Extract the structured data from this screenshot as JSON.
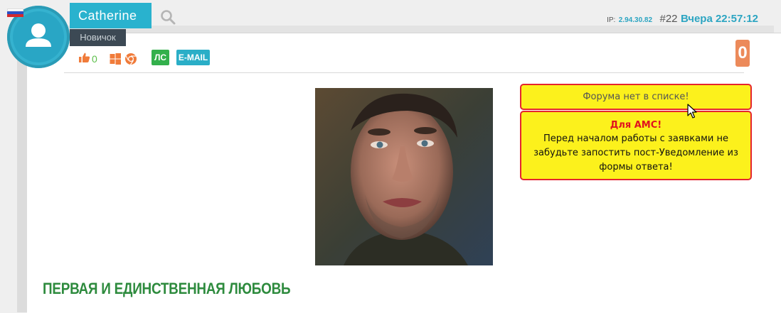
{
  "user": {
    "name": "Catherine",
    "rank": "Новичок",
    "flag": "russia-flag-icon",
    "avatar_icon": "default-user-avatar-icon"
  },
  "meta": {
    "ip_label": "IP:",
    "ip_value": "2.94.30.82",
    "post_number": "#22",
    "date": "Вчера 22:57:12"
  },
  "actions": {
    "reputation": "0",
    "pm_label": "ЛС",
    "email_label": "E-MAIL",
    "counter": "0"
  },
  "notices": {
    "forum_status": "Форума нет в списке!",
    "ams_title": "Для АМС!",
    "ams_body": "Перед началом работы с заявками не забудьте запостить пост-Уведомление из формы ответа!"
  },
  "post": {
    "title": "ПЕРВАЯ И ЕДИНСТВЕННАЯ ЛЮБОВЬ"
  },
  "colors": {
    "accent": "#29b2ce",
    "rank_bg": "#3c4954",
    "notice_bg": "#fcf11c",
    "notice_border": "#e5252f",
    "title_green": "#2e8b3e",
    "counter_orange": "#ec8a5a"
  }
}
